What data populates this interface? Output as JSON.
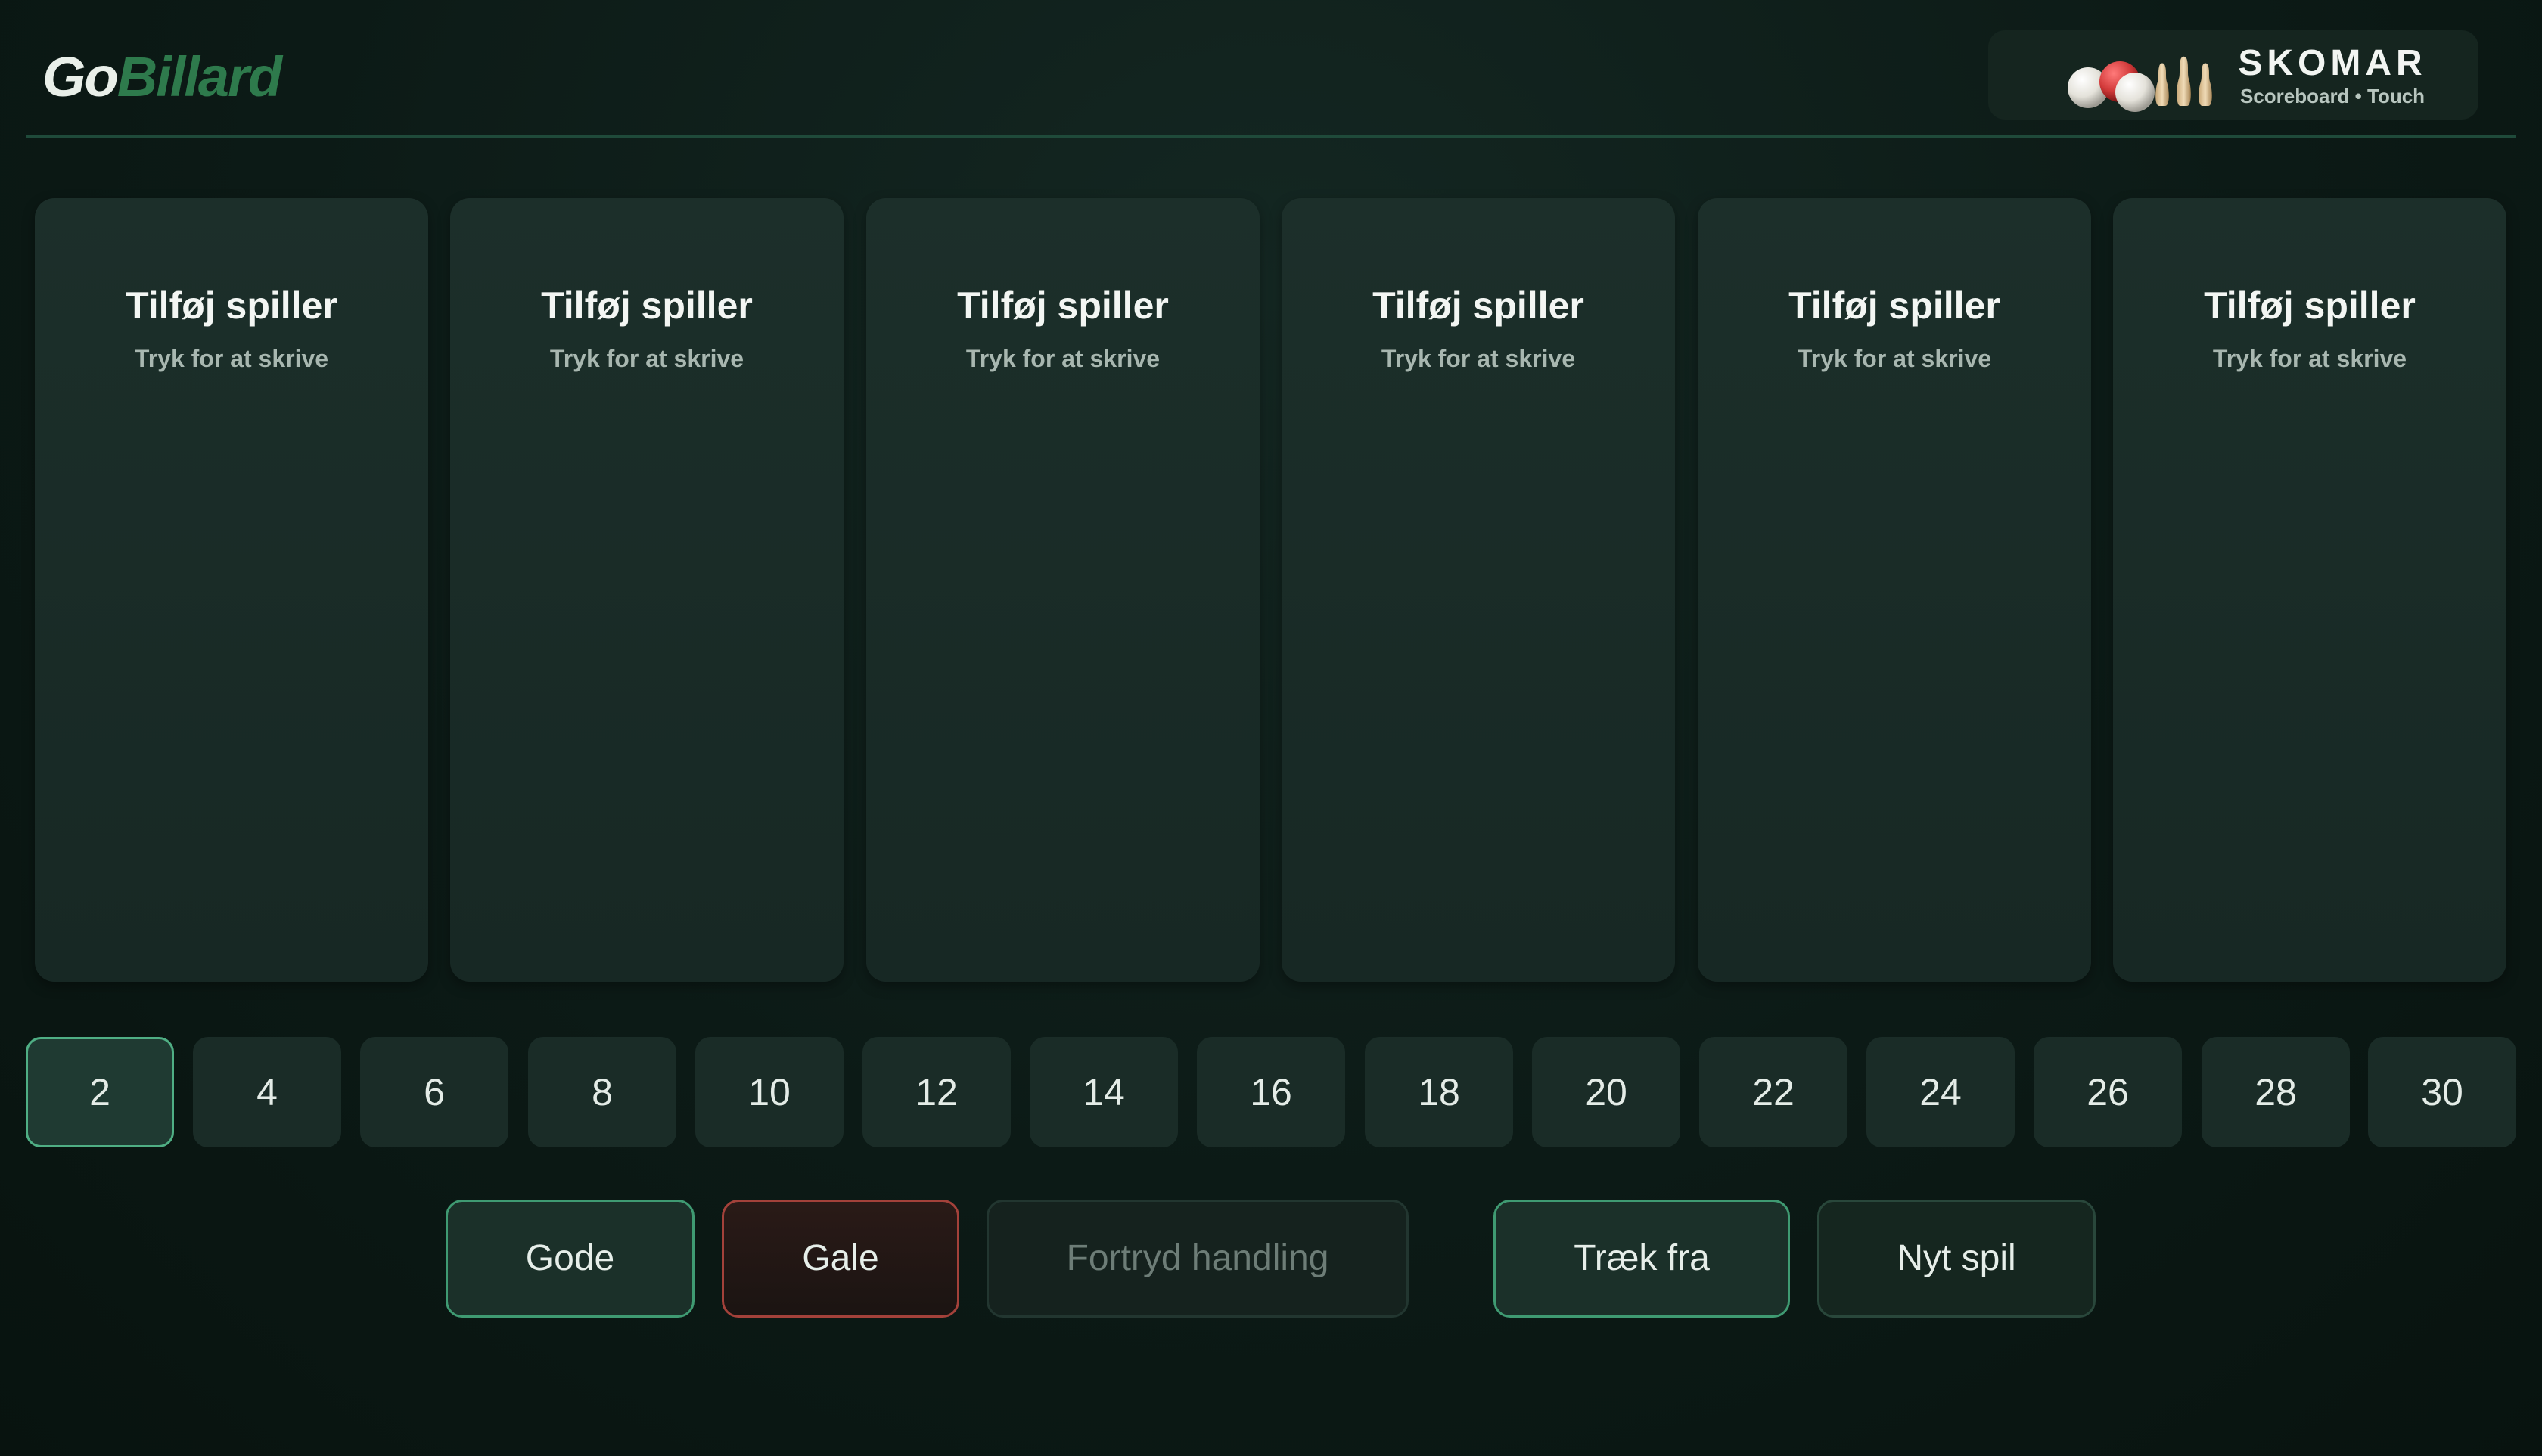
{
  "header": {
    "logo": {
      "part1": "Go",
      "part2": "Billard"
    },
    "brand": {
      "title": "SKOMAR",
      "subtitle": "Scoreboard • Touch",
      "art_icon": "billiard-balls-and-pins-icon"
    }
  },
  "players": [
    {
      "name": "Tilføj spiller",
      "hint": "Tryk for at skrive"
    },
    {
      "name": "Tilføj spiller",
      "hint": "Tryk for at skrive"
    },
    {
      "name": "Tilføj spiller",
      "hint": "Tryk for at skrive"
    },
    {
      "name": "Tilføj spiller",
      "hint": "Tryk for at skrive"
    },
    {
      "name": "Tilføj spiller",
      "hint": "Tryk for at skrive"
    },
    {
      "name": "Tilføj spiller",
      "hint": "Tryk for at skrive"
    }
  ],
  "points": {
    "selected": "2",
    "options": [
      "2",
      "4",
      "6",
      "8",
      "10",
      "12",
      "14",
      "16",
      "18",
      "20",
      "22",
      "24",
      "26",
      "28",
      "30"
    ]
  },
  "actions": {
    "gode": "Gode",
    "gale": "Gale",
    "fortryd": "Fortryd handling",
    "traek": "Træk fra",
    "nyt": "Nyt spil"
  },
  "colors": {
    "accent_green": "#4fae84",
    "logo_green": "#2e7a4c",
    "danger_red": "#a3413a",
    "background": "#0c1a16"
  }
}
